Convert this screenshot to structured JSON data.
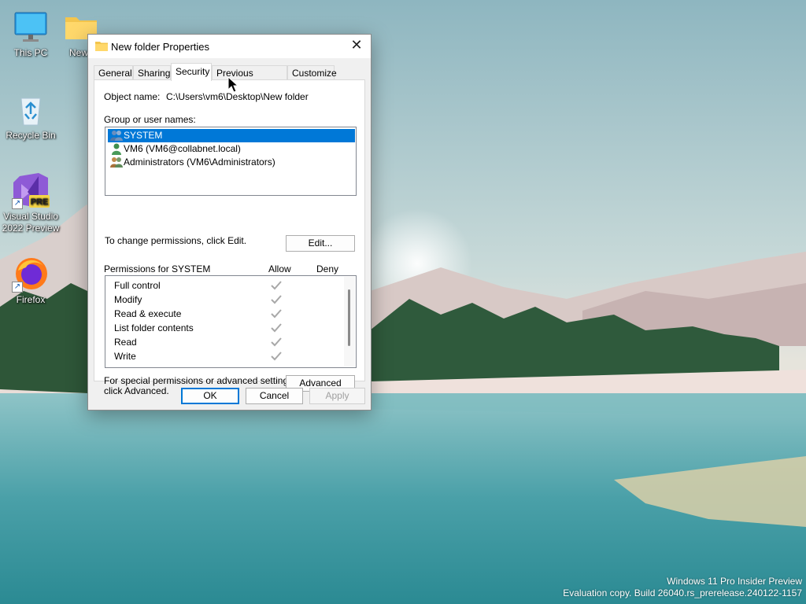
{
  "desktop": {
    "icons": [
      {
        "label": "This PC"
      },
      {
        "label": "New"
      },
      {
        "label": "Recycle Bin"
      },
      {
        "label_line1": "Visual Studio",
        "label_line2": "2022 Preview",
        "badge": "PRE"
      },
      {
        "label": "Firefox"
      }
    ],
    "watermark": {
      "line1": "Windows 11 Pro Insider Preview",
      "line2": "Evaluation copy. Build 26040.rs_prerelease.240122-1157"
    }
  },
  "dialog": {
    "title": "New folder Properties",
    "close_glyph": "✕",
    "tabs": [
      {
        "label": "General"
      },
      {
        "label": "Sharing"
      },
      {
        "label": "Security",
        "active": true
      },
      {
        "label": "Previous Versions"
      },
      {
        "label": "Customize"
      }
    ],
    "security": {
      "object_name_label": "Object name:",
      "object_name_value": "C:\\Users\\vm6\\Desktop\\New folder",
      "group_label": "Group or user names:",
      "users": [
        {
          "label": "SYSTEM",
          "icon": "users-group-icon",
          "selected": true
        },
        {
          "label": "VM6 (VM6@collabnet.local)",
          "icon": "user-icon",
          "selected": false
        },
        {
          "label": "Administrators (VM6\\Administrators)",
          "icon": "users-group-icon",
          "selected": false
        }
      ],
      "change_hint": "To change permissions, click Edit.",
      "edit_button": "Edit...",
      "permissions_for": "Permissions for SYSTEM",
      "allow_header": "Allow",
      "deny_header": "Deny",
      "permissions": [
        {
          "name": "Full control",
          "allow": true,
          "deny": false
        },
        {
          "name": "Modify",
          "allow": true,
          "deny": false
        },
        {
          "name": "Read & execute",
          "allow": true,
          "deny": false
        },
        {
          "name": "List folder contents",
          "allow": true,
          "deny": false
        },
        {
          "name": "Read",
          "allow": true,
          "deny": false
        },
        {
          "name": "Write",
          "allow": true,
          "deny": false
        }
      ],
      "special_line1": "For special permissions or advanced settings,",
      "special_line2": "click Advanced.",
      "advanced_button": "Advanced"
    },
    "buttons": {
      "ok": "OK",
      "cancel": "Cancel",
      "apply": "Apply"
    }
  },
  "colors": {
    "selection": "#0078d7",
    "check_gray": "#a8a8a8"
  }
}
